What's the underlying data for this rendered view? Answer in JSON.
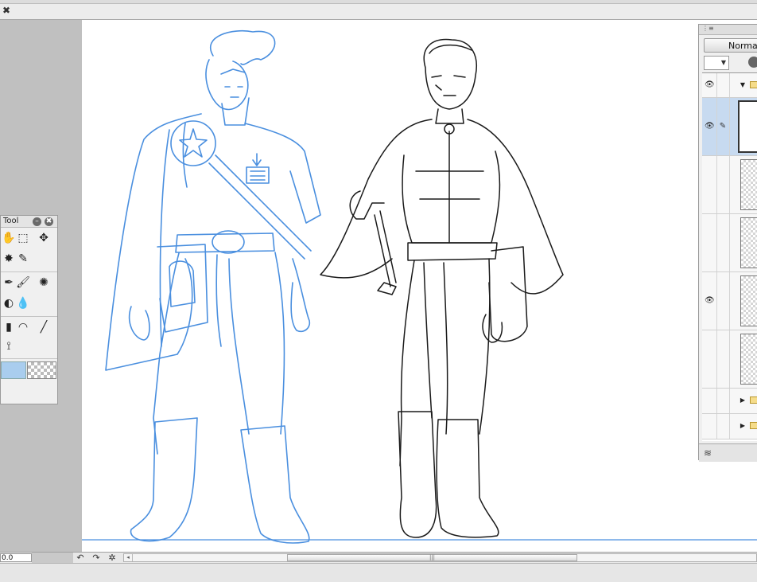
{
  "window": {
    "close_symbol": "✖"
  },
  "tool_panel": {
    "title": "Tool",
    "minimize_symbol": "–",
    "close_symbol": "✖",
    "tools_row1": [
      "hand-tool-icon",
      "3d-cube-icon",
      "move-arrows-icon"
    ],
    "tools_row2": [
      "sparkle-icon",
      "eyedropper-icon"
    ],
    "tools_row3": [
      "pen-icon",
      "brush-icon",
      "spray-icon"
    ],
    "tools_row4": [
      "blend-icon",
      "ink-drop-icon"
    ],
    "tools_row5": [
      "gradient-icon",
      "curve-icon",
      "line-icon"
    ],
    "tools_row6": [
      "branch-icon"
    ],
    "main_color": "#a9cdee"
  },
  "layer_panel": {
    "blend_mode": "Normal",
    "opacity_display": "",
    "rows": [
      {
        "type": "folder",
        "visible": true,
        "expanded": true
      },
      {
        "type": "layer",
        "visible": true,
        "selected": true,
        "editing": true
      },
      {
        "type": "layer",
        "visible": false
      },
      {
        "type": "layer",
        "visible": false
      },
      {
        "type": "layer",
        "visible": true
      },
      {
        "type": "layer",
        "visible": false
      },
      {
        "type": "folder",
        "visible": false,
        "expanded": false
      },
      {
        "type": "folder",
        "visible": false,
        "expanded": false
      }
    ]
  },
  "statusbar": {
    "zoom_value": "0.0",
    "undo_symbol": "↶",
    "redo_symbol": "↷",
    "rotate_symbol": "✲",
    "scroll_left_symbol": "◂",
    "scroll_grip": "|||"
  },
  "colors": {
    "sketch_blue": "#4a8fdf",
    "ink_black": "#1a1a1a",
    "canvas_bg": "#ffffff",
    "workspace_gray": "#c0c0c0"
  }
}
